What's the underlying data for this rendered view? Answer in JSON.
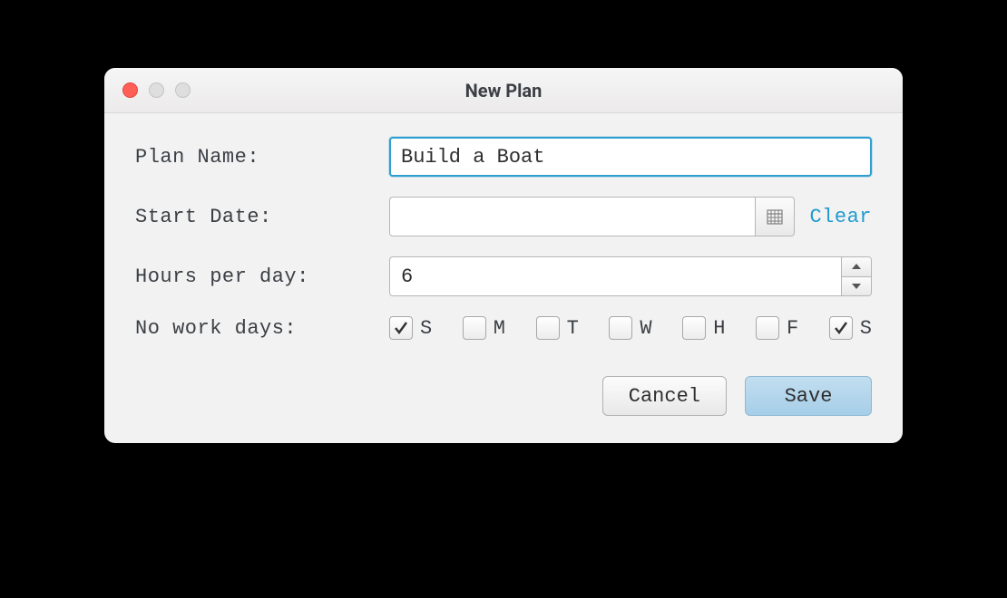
{
  "window": {
    "title": "New Plan"
  },
  "form": {
    "plan_name": {
      "label": "Plan Name:",
      "value": "Build a Boat"
    },
    "start_date": {
      "label": "Start Date:",
      "value": "",
      "clear_label": "Clear"
    },
    "hours_per_day": {
      "label": "Hours per day:",
      "value": "6"
    },
    "no_work_days": {
      "label": "No work days:",
      "days": [
        {
          "letter": "S",
          "checked": true
        },
        {
          "letter": "M",
          "checked": false
        },
        {
          "letter": "T",
          "checked": false
        },
        {
          "letter": "W",
          "checked": false
        },
        {
          "letter": "H",
          "checked": false
        },
        {
          "letter": "F",
          "checked": false
        },
        {
          "letter": "S",
          "checked": true
        }
      ]
    }
  },
  "buttons": {
    "cancel": "Cancel",
    "save": "Save"
  }
}
